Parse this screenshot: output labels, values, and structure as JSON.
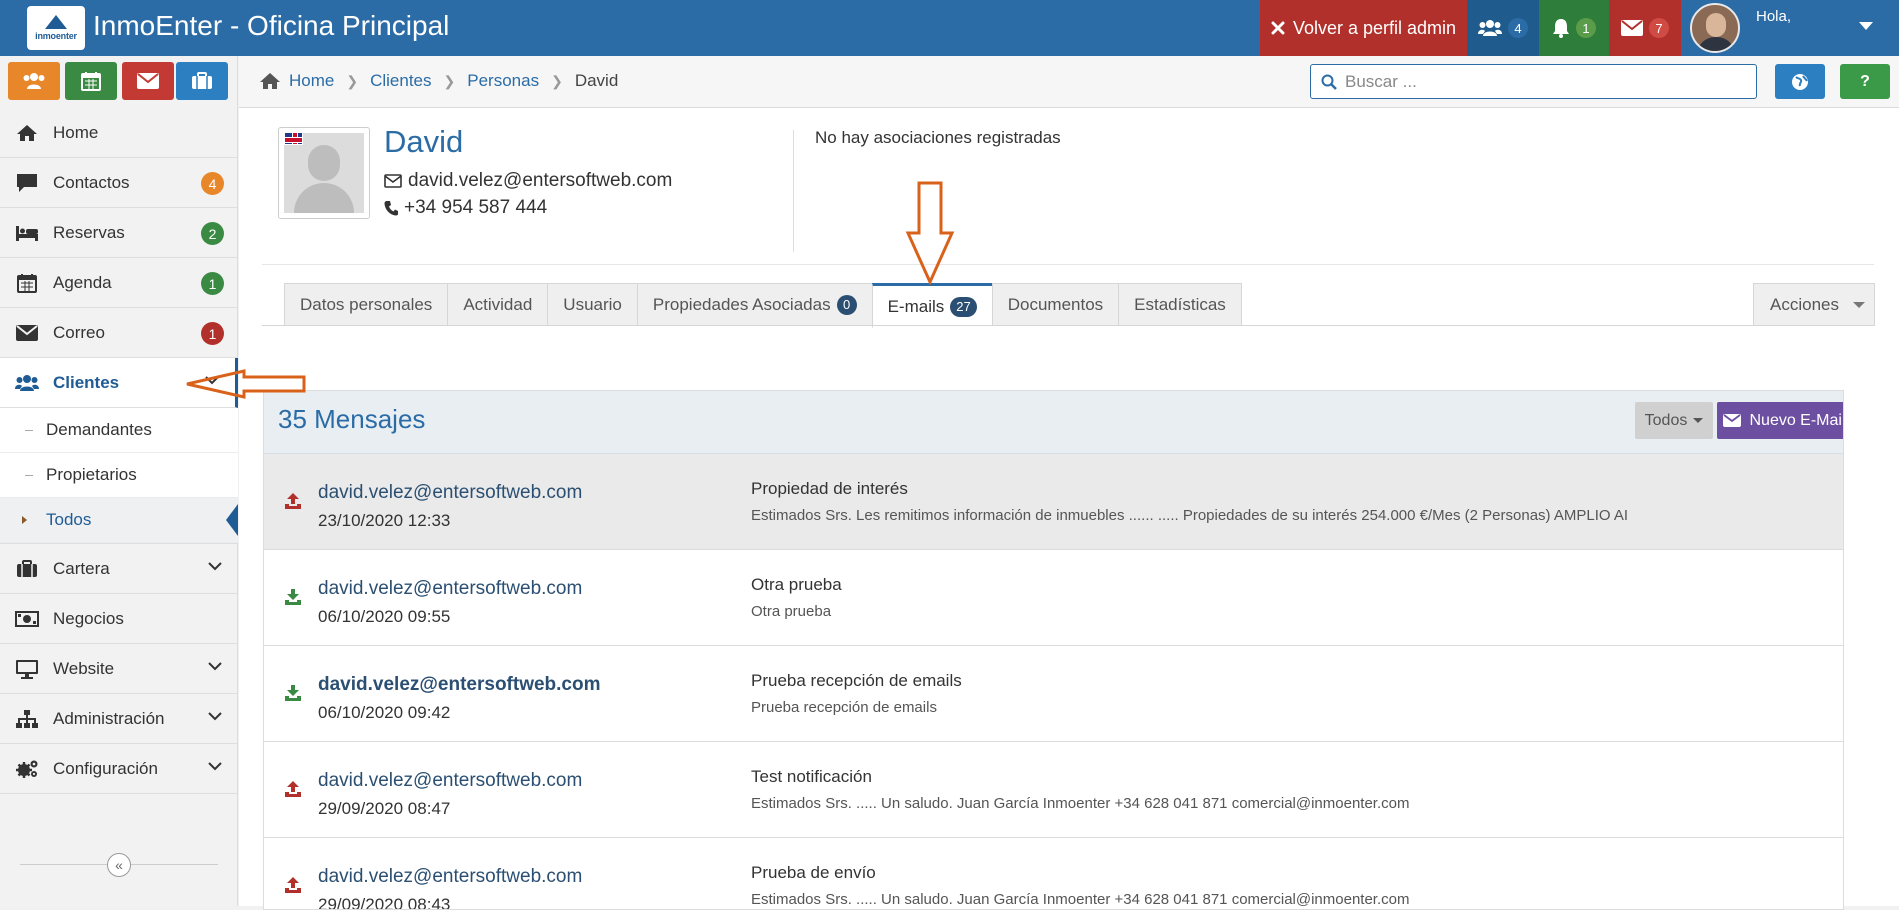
{
  "app": {
    "title": "InmoEnter - Oficina Principal",
    "logo_text": "inmoenter"
  },
  "topnav": {
    "admin_label": "Volver a perfil admin",
    "users_count": "4",
    "notifications_count": "1",
    "messages_count": "7",
    "greeting": "Hola,"
  },
  "sidebar": {
    "items": [
      {
        "label": "Home"
      },
      {
        "label": "Contactos",
        "badge": "4",
        "badge_color": "#e8862a"
      },
      {
        "label": "Reservas",
        "badge": "2",
        "badge_color": "#3a8a44"
      },
      {
        "label": "Agenda",
        "badge": "1",
        "badge_color": "#3a8a44"
      },
      {
        "label": "Correo",
        "badge": "1",
        "badge_color": "#b2302b"
      },
      {
        "label": "Clientes"
      },
      {
        "label": "Cartera"
      },
      {
        "label": "Negocios"
      },
      {
        "label": "Website"
      },
      {
        "label": "Administración"
      },
      {
        "label": "Configuración"
      }
    ],
    "clientes_sub": [
      {
        "label": "Demandantes"
      },
      {
        "label": "Propietarios"
      },
      {
        "label": "Todos"
      }
    ]
  },
  "breadcrumb": {
    "items": [
      "Home",
      "Clientes",
      "Personas",
      "David"
    ]
  },
  "search": {
    "placeholder": "Buscar ..."
  },
  "header_buttons": {
    "help": "?"
  },
  "person": {
    "name": "David",
    "email": "david.velez@entersoftweb.com",
    "phone": "+34 954 587 444",
    "associations": "No hay asociaciones registradas"
  },
  "tabs": [
    {
      "label": "Datos personales"
    },
    {
      "label": "Actividad"
    },
    {
      "label": "Usuario"
    },
    {
      "label": "Propiedades Asociadas",
      "badge": "0"
    },
    {
      "label": "E-mails",
      "badge": "27",
      "active": true
    },
    {
      "label": "Documentos"
    },
    {
      "label": "Estadísticas"
    }
  ],
  "actions_label": "Acciones",
  "messages": {
    "title": "35 Mensajes",
    "filter_label": "Todos",
    "new_label": "Nuevo E-Mail",
    "rows": [
      {
        "direction": "sent",
        "from": "david.velez@entersoftweb.com",
        "date": "23/10/2020 12:33",
        "subject": "Propiedad de interés",
        "preview": "Estimados Srs. Les remitimos información de inmuebles ...... ..... Propiedades de su interés 254.000 €/Mes (2 Personas) AMPLIO AI"
      },
      {
        "direction": "received",
        "from": "david.velez@entersoftweb.com",
        "date": "06/10/2020 09:55",
        "subject": "Otra prueba",
        "preview": "Otra prueba"
      },
      {
        "direction": "received",
        "from": "david.velez@entersoftweb.com",
        "date": "06/10/2020 09:42",
        "subject": "Prueba recepción de emails",
        "preview": "Prueba recepción de emails"
      },
      {
        "direction": "sent",
        "from": "david.velez@entersoftweb.com",
        "date": "29/09/2020 08:47",
        "subject": "Test notificación",
        "preview": "Estimados Srs. ..... Un saludo. Juan García Inmoenter +34 628 041 871 comercial@inmoenter.com"
      },
      {
        "direction": "sent",
        "from": "david.velez@entersoftweb.com",
        "date": "29/09/2020 08:43",
        "subject": "Prueba de envío",
        "preview": "Estimados Srs. ..... Un saludo. Juan García Inmoenter +34 628 041 871 comercial@inmoenter.com"
      }
    ]
  },
  "colors": {
    "brand": "#2b6ca6",
    "sent_icon": "#b2302b",
    "received_icon": "#3a8a44",
    "annotation_arrow": "#d9621a"
  }
}
